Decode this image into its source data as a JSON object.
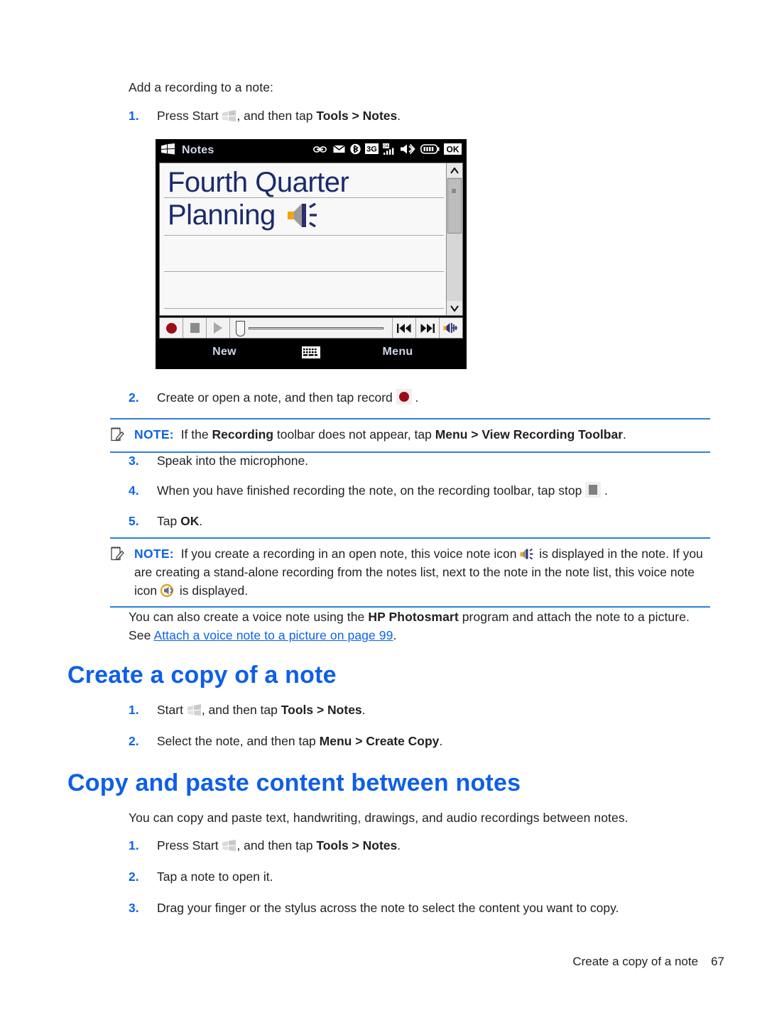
{
  "document": {
    "lead_in": "Add a recording to a note:",
    "footer_title": "Create a copy of a note",
    "page_number": "67"
  },
  "colors": {
    "heading_blue": "#0d5fe8",
    "step_number_blue": "#0d63e8",
    "note_rule_blue": "#2f7fd8",
    "link_blue": "#0d63e8",
    "body_text": "#231f20",
    "record_red": "#9c0c18",
    "note_ink": "#1c2a6b"
  },
  "procedure_recording": {
    "steps": [
      {
        "num": "1.",
        "parts": [
          {
            "t": "text",
            "v": "Press Start "
          },
          {
            "t": "icon",
            "v": "windows-start-icon"
          },
          {
            "t": "text",
            "v": ", and then tap "
          },
          {
            "t": "bold",
            "v": "Tools > Notes"
          },
          {
            "t": "text",
            "v": "."
          }
        ]
      },
      {
        "num": "2.",
        "parts": [
          {
            "t": "text",
            "v": "Create or open a note, and then tap record "
          },
          {
            "t": "icon",
            "v": "record-button-icon"
          },
          {
            "t": "text",
            "v": " ."
          }
        ]
      },
      {
        "num": "3.",
        "parts": [
          {
            "t": "text",
            "v": "Speak into the microphone."
          }
        ]
      },
      {
        "num": "4.",
        "parts": [
          {
            "t": "text",
            "v": "When you have finished recording the note, on the recording toolbar, tap stop "
          },
          {
            "t": "icon",
            "v": "stop-button-icon"
          },
          {
            "t": "text",
            "v": " ."
          }
        ]
      },
      {
        "num": "5.",
        "parts": [
          {
            "t": "text",
            "v": "Tap "
          },
          {
            "t": "bold",
            "v": "OK"
          },
          {
            "t": "text",
            "v": "."
          }
        ]
      }
    ]
  },
  "note_1": {
    "icon": "note-pencil-icon",
    "label": "NOTE:",
    "text_a": "If the ",
    "bold_a": "Recording",
    "text_b": " toolbar does not appear, tap ",
    "bold_b": "Menu > View Recording Toolbar",
    "text_c": "."
  },
  "note_2": {
    "icon": "note-pencil-icon",
    "label": "NOTE:",
    "text_a": "If you create a recording in an open note, this voice note icon ",
    "icon_inline_a": "voice-note-speaker-icon",
    "text_b": " is displayed in the note. If you are creating a stand-alone recording from the notes list, next to the note in the note list, this voice note icon ",
    "icon_inline_b": "voice-note-circle-icon",
    "text_c": " is displayed."
  },
  "photosmart_paragraph": {
    "text_a": "You can also create a voice note using the ",
    "bold_a": "HP Photosmart",
    "text_b": " program and attach the note to a picture. See ",
    "link": "Attach a voice note to a picture on page 99",
    "text_c": "."
  },
  "section_create_copy": {
    "heading": "Create a copy of a note",
    "steps": [
      {
        "num": "1.",
        "parts": [
          {
            "t": "text",
            "v": "Start "
          },
          {
            "t": "icon",
            "v": "windows-start-icon"
          },
          {
            "t": "text",
            "v": ", and then tap "
          },
          {
            "t": "bold",
            "v": "Tools > Notes"
          },
          {
            "t": "text",
            "v": "."
          }
        ]
      },
      {
        "num": "2.",
        "parts": [
          {
            "t": "text",
            "v": "Select the note, and then tap "
          },
          {
            "t": "bold",
            "v": "Menu > Create Copy"
          },
          {
            "t": "text",
            "v": "."
          }
        ]
      }
    ]
  },
  "section_copy_paste": {
    "heading": "Copy and paste content between notes",
    "intro": "You can copy and paste text, handwriting, drawings, and audio recordings between notes.",
    "steps": [
      {
        "num": "1.",
        "parts": [
          {
            "t": "text",
            "v": "Press Start "
          },
          {
            "t": "icon",
            "v": "windows-start-icon"
          },
          {
            "t": "text",
            "v": ", and then tap "
          },
          {
            "t": "bold",
            "v": "Tools > Notes"
          },
          {
            "t": "text",
            "v": "."
          }
        ]
      },
      {
        "num": "2.",
        "parts": [
          {
            "t": "text",
            "v": "Tap a note to open it."
          }
        ]
      },
      {
        "num": "3.",
        "parts": [
          {
            "t": "text",
            "v": "Drag your finger or the stylus across the note to select the content you want to copy."
          }
        ]
      }
    ]
  },
  "device_screenshot": {
    "title": "Notes",
    "start_icon": "windows-flag-icon",
    "status_icons": [
      "voicemail-icon",
      "envelope-icon",
      "bluetooth-icon",
      "3g-icon",
      "signal-bars-icon",
      "volume-icon",
      "battery-icon",
      "ok-button"
    ],
    "status_3g_label": "3G",
    "ok_label": "OK",
    "note_line_1": "Fourth Quarter",
    "note_line_2": "Planning",
    "note_voice_icon": "voice-note-speaker-icon",
    "recording_toolbar": {
      "record": "record-button",
      "stop": "stop-button",
      "play": "play-button",
      "slider": "playback-slider",
      "rewind": "rewind-button",
      "forward": "forward-button",
      "volume": "volume-button"
    },
    "softkeys": {
      "left": "New",
      "center_icon": "keyboard-icon",
      "right": "Menu"
    }
  }
}
